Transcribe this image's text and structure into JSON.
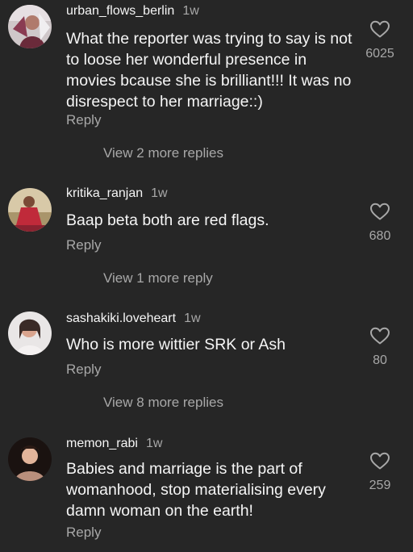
{
  "comments": [
    {
      "username": "urban_flows_berlin",
      "time": "1w",
      "text": "What the reporter was trying to say is not to loose her wonderful presence in movies bcause she is brilliant!!! It was no disrespect to her marriage::)",
      "likes": "6025",
      "reply_label": "Reply",
      "view_more": "View 2 more replies"
    },
    {
      "username": "kritika_ranjan",
      "time": "1w",
      "text": "Baap beta both are red flags.",
      "likes": "680",
      "reply_label": "Reply",
      "view_more": "View 1 more reply"
    },
    {
      "username": "sashakiki.loveheart",
      "time": "1w",
      "text": "Who is more wittier SRK or Ash",
      "likes": "80",
      "reply_label": "Reply",
      "view_more": "View 8 more replies"
    },
    {
      "username": "memon_rabi",
      "time": "1w",
      "text": "Babies and marriage is the part of womanhood, stop materialising every damn woman on the earth!",
      "likes": "259",
      "reply_label": "Reply"
    }
  ],
  "icons": {
    "like": "heart-outline-icon",
    "avatar": "user-avatar"
  },
  "colors": {
    "background": "#262626",
    "primary_text": "#f5f5f5",
    "secondary_text": "#a8a8a8"
  }
}
